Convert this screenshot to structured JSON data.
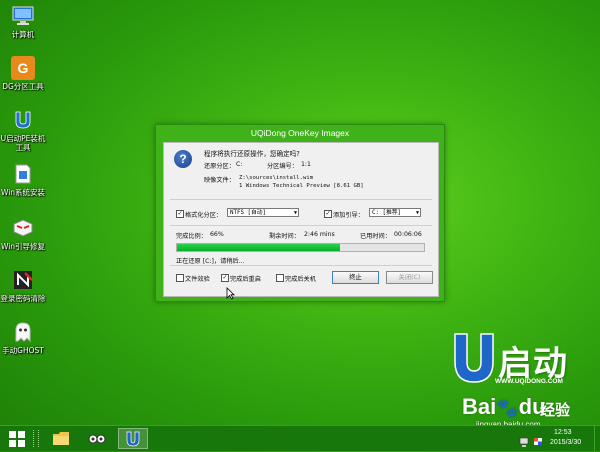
{
  "desktop": {
    "icons": [
      {
        "label_line1": "计算机",
        "label_line2": "",
        "icon": "computer-icon"
      },
      {
        "label_line1": "DG分区工具",
        "label_line2": "",
        "icon": "diskgenius-icon"
      },
      {
        "label_line1": "U启动PE装机",
        "label_line2": "工具",
        "icon": "uqidong-installer-icon"
      },
      {
        "label_line1": "Win系统安装",
        "label_line2": "",
        "icon": "windows-install-icon"
      },
      {
        "label_line1": "Win引导修复",
        "label_line2": "",
        "icon": "boot-repair-icon"
      },
      {
        "label_line1": "登录密码清除",
        "label_line2": "",
        "icon": "password-clear-icon"
      },
      {
        "label_line1": "手动GHOST",
        "label_line2": "",
        "icon": "ghost-icon"
      }
    ]
  },
  "dialog": {
    "title": "UQiDong OneKey Imagex",
    "prompt": "程序将执行还原操作，您确定吗?",
    "restore_partition_label": "还原分区：",
    "restore_partition_value": "C:",
    "partition_number_label": "分区编号：",
    "partition_number_value": "1:1",
    "image_file_label": "映像文件：",
    "image_file_path": "Z:\\sources\\install.wim",
    "image_file_desc": "1 Windows Technical Preview [8.61 GB]",
    "format_checkbox_label": "格式化分区：",
    "format_value": "NTFS [自动]",
    "bootloader_checkbox_label": "添加引导：",
    "bootloader_value": "C: [推荐]",
    "progress_label": "完成比例：",
    "progress_value": "66%",
    "progress_fraction": 0.66,
    "remaining_label": "剩余时间：",
    "remaining_value": "2:46 mins",
    "elapsed_label": "已用时间：",
    "elapsed_value": "00:06:06",
    "status_text": "正在还原 [C:]，请稍后...",
    "opt_verify": "文件效验",
    "opt_reboot": "完成后重启",
    "opt_shutdown": "完成后关机",
    "stop_button": "终止",
    "close_button": "关闭(C)"
  },
  "brand": {
    "name": "启动",
    "url": "WWW.UQIDONG.COM"
  },
  "watermark": {
    "logo": "Bai",
    "logo_suffix": "du",
    "cn": "经验",
    "url": "jingyan.baidu.com"
  },
  "taskbar": {
    "time": "12:53",
    "date": "2015/3/30"
  },
  "colors": {
    "desktop_green": "#3fb312",
    "dialog_frame": "#3fb21a",
    "progress_green": "#06b025",
    "taskbar": "#17770a"
  }
}
